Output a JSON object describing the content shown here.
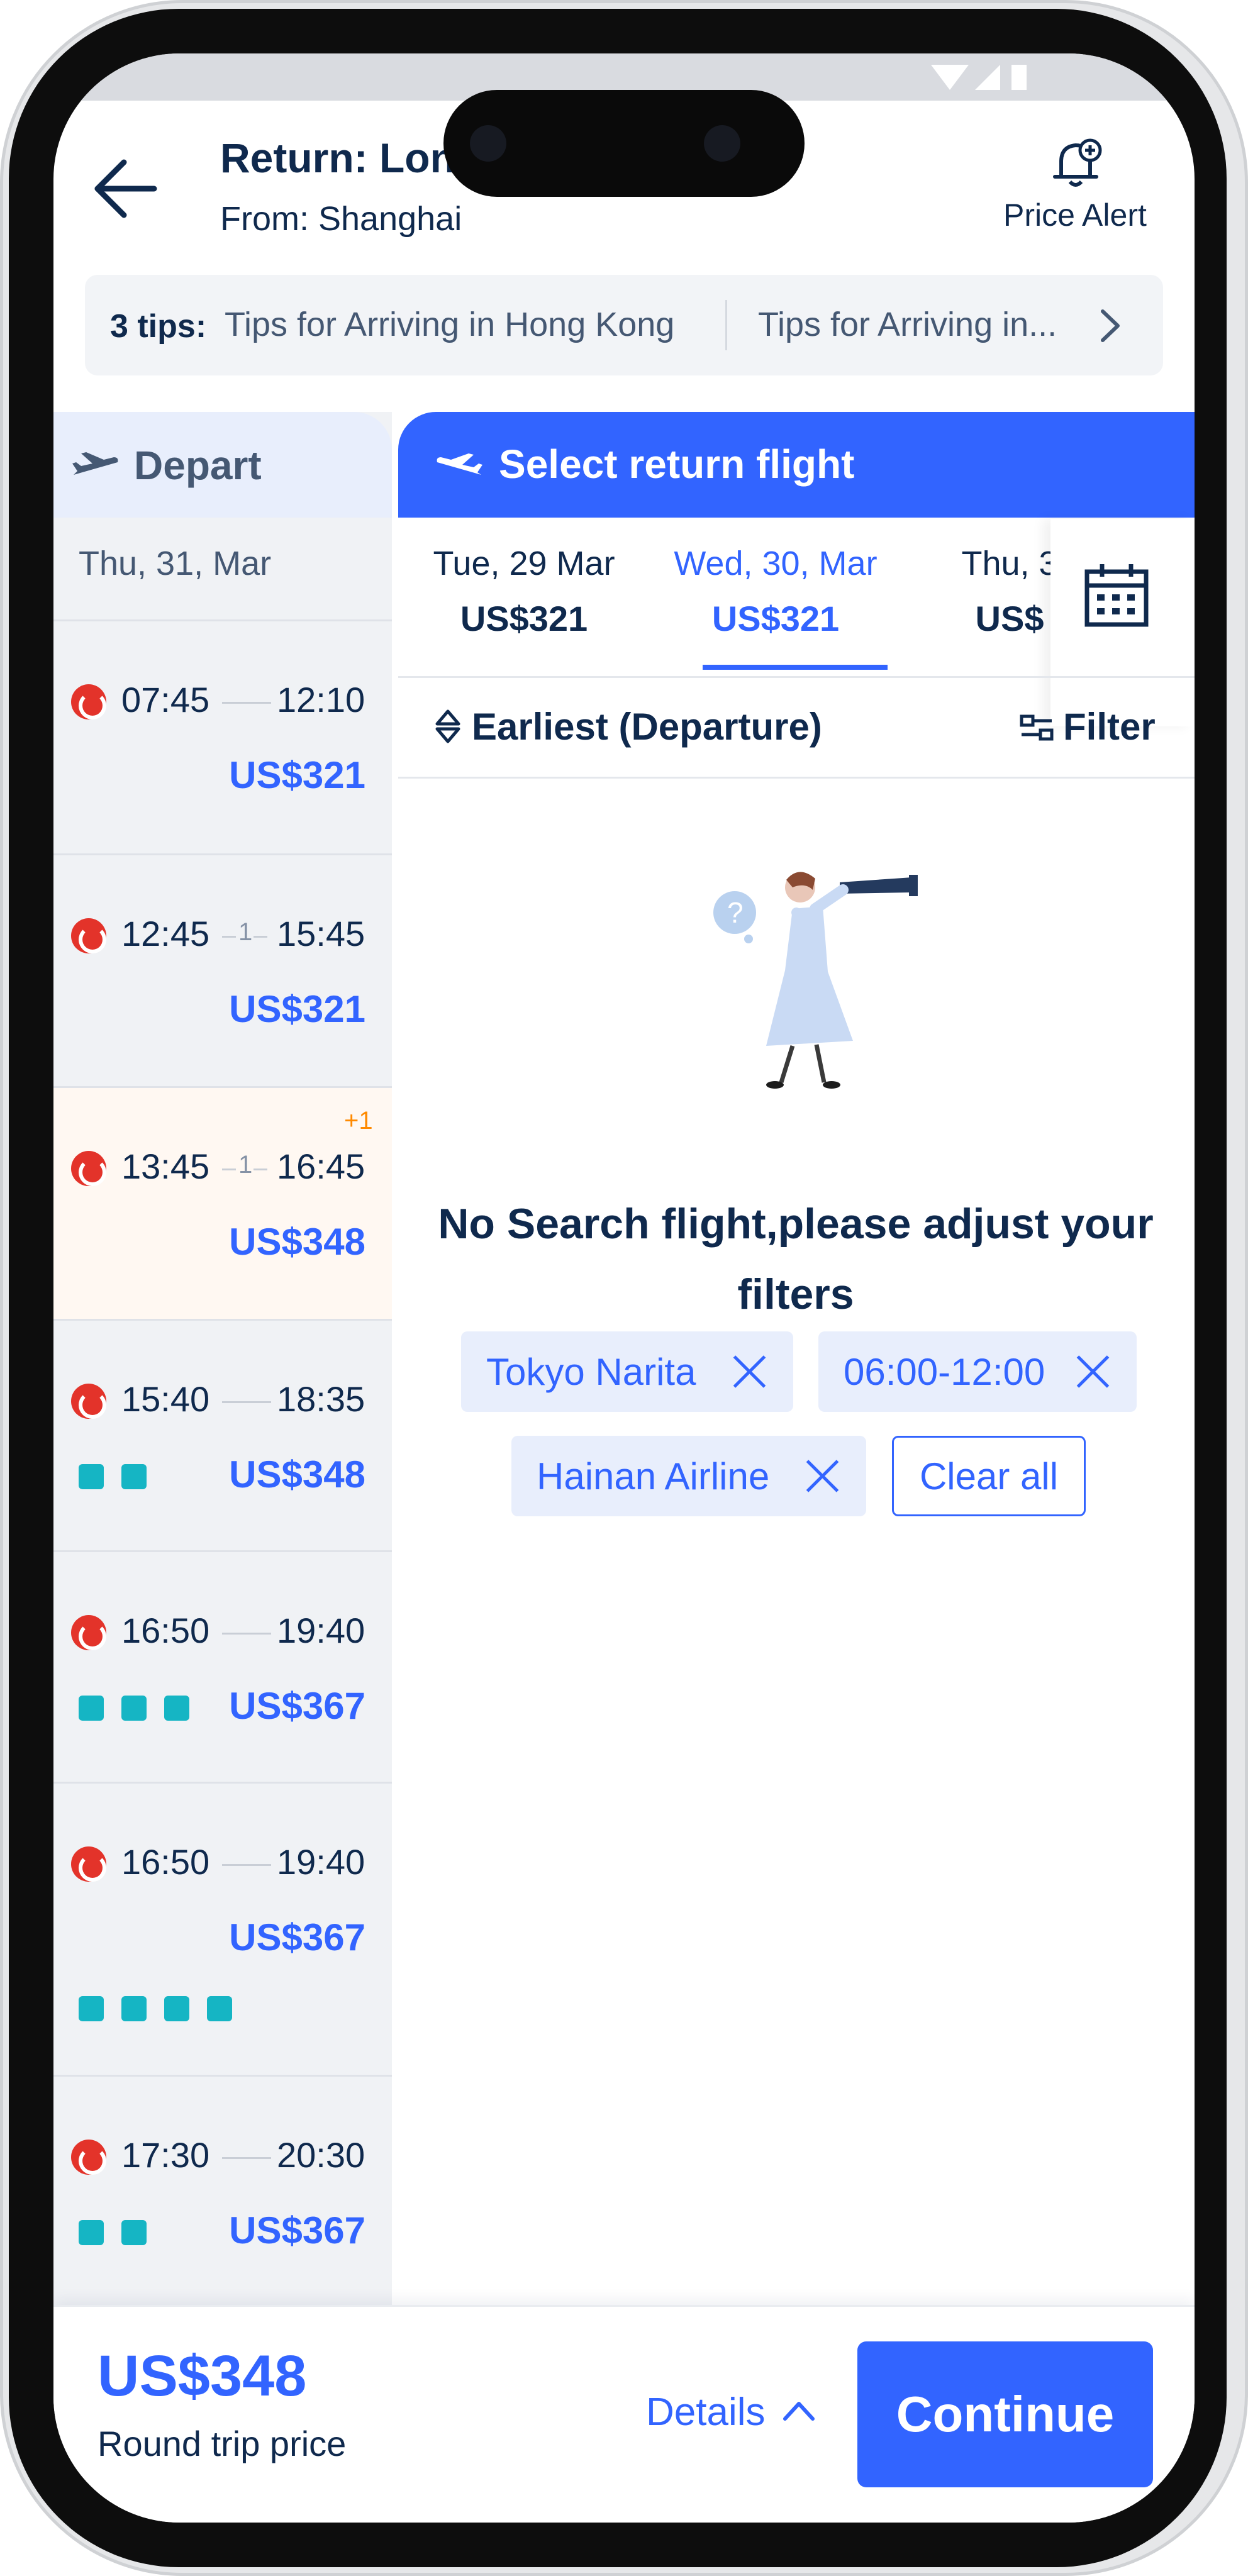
{
  "header": {
    "title": "Return: Lon",
    "subtitle": "From: Shanghai",
    "price_alert_label": "Price Alert"
  },
  "tips": {
    "count_label": "3 tips:",
    "items": [
      "Tips for Arriving in Hong Kong",
      "Tips for Arriving in..."
    ]
  },
  "tabs": {
    "depart_label": "Depart",
    "return_label": "Select return flight"
  },
  "depart_date": "Thu, 31, Mar",
  "depart_flights": [
    {
      "dep": "07:45",
      "stops": "",
      "arr": "12:10",
      "price": "US$321",
      "next_day": ""
    },
    {
      "dep": "12:45",
      "stops": "1",
      "arr": "15:45",
      "price": "US$321",
      "next_day": ""
    },
    {
      "dep": "13:45",
      "stops": "1",
      "arr": "16:45",
      "price": "US$348",
      "next_day": "+1"
    },
    {
      "dep": "15:40",
      "stops": "",
      "arr": "18:35",
      "price": "US$348",
      "next_day": ""
    },
    {
      "dep": "16:50",
      "stops": "",
      "arr": "19:40",
      "price": "US$367",
      "next_day": ""
    },
    {
      "dep": "16:50",
      "stops": "",
      "arr": "19:40",
      "price": "US$367",
      "next_day": ""
    },
    {
      "dep": "17:30",
      "stops": "",
      "arr": "20:30",
      "price": "US$367",
      "next_day": ""
    }
  ],
  "return_dates": [
    {
      "date": "Tue, 29 Mar",
      "price": "US$321",
      "selected": false
    },
    {
      "date": "Wed, 30, Mar",
      "price": "US$321",
      "selected": true
    },
    {
      "date": "Thu, 3",
      "price": "US$",
      "selected": false
    }
  ],
  "sort": {
    "label": "Earliest (Departure)",
    "filter_label": "Filter"
  },
  "empty_state": {
    "message": "No Search flight,please adjust your filters"
  },
  "active_filters": [
    "Tokyo Narita",
    "06:00-12:00",
    "Hainan Airline"
  ],
  "clear_all_label": "Clear all",
  "footer": {
    "total_price": "US$348",
    "total_label": "Round trip price",
    "details_label": "Details",
    "continue_label": "Continue"
  },
  "colors": {
    "accent": "#3264ff",
    "text": "#0f294d",
    "selected_row": "#fff8f2",
    "amenity": "#15b5c4",
    "airline": "#e3332a",
    "next_day": "#ff8a00"
  }
}
